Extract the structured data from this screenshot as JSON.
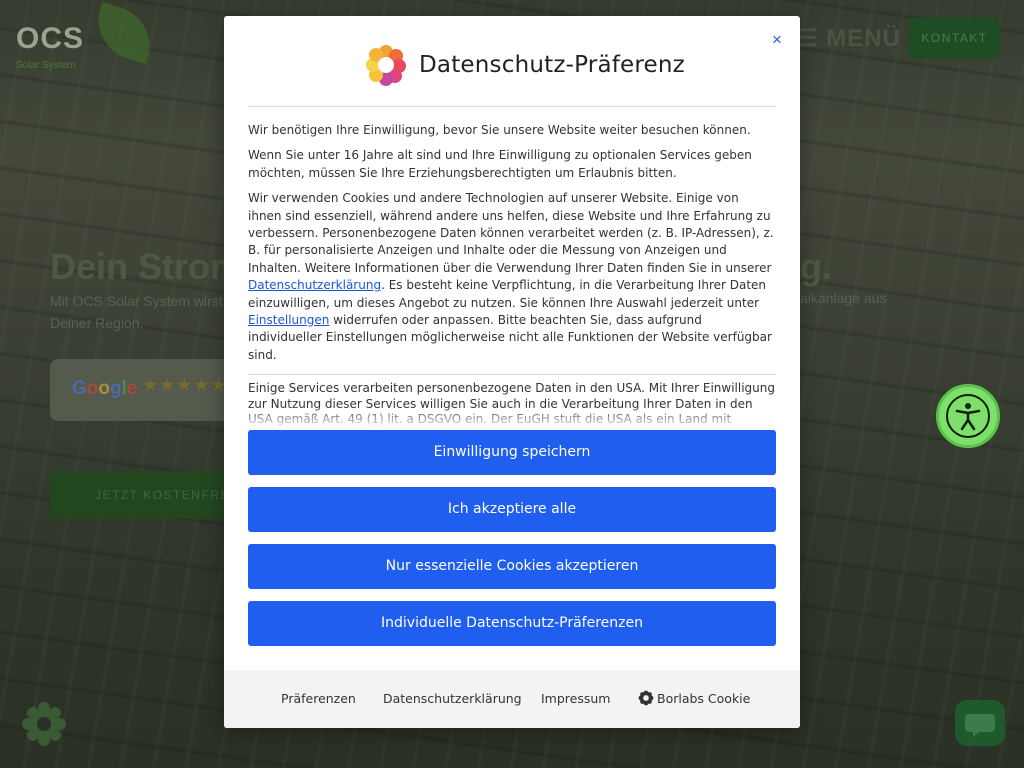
{
  "site": {
    "logo_text": "OCS",
    "logo_sub": "Solar System",
    "menu_label": "MENÜ",
    "contact_label": "KONTAKT",
    "hero_title_left": "Dein Strom",
    "hero_title_right": "g.",
    "hero_sub_left": "Mit OCS Solar System wirst Deiner Region.",
    "hero_sub_right": "aikanlage aus",
    "google_label": "Google",
    "google_stars": "★★★★★",
    "cta_label": "JETZT KOSTENFREIES"
  },
  "dialog": {
    "title": "Datenschutz-Präferenz",
    "close_symbol": "×",
    "paragraph1": "Wir benötigen Ihre Einwilligung, bevor Sie unsere Website weiter besuchen können.",
    "paragraph2": "Wenn Sie unter 16 Jahre alt sind und Ihre Einwilligung zu optionalen Services geben möchten, müssen Sie Ihre Erziehungsberechtigten um Erlaubnis bitten.",
    "paragraph3_part1": "Wir verwenden Cookies und andere Technologien auf unserer Website. Einige von ihnen sind essenziell, während andere uns helfen, diese Website und Ihre Erfahrung zu verbessern. Personenbezogene Daten können verarbeitet werden (z. B. IP-Adressen), z. B. für personalisierte Anzeigen und Inhalte oder die Messung von Anzeigen und Inhalten. Weitere Informationen über die Verwendung Ihrer Daten finden Sie in unserer ",
    "paragraph3_link1": "Datenschutzerklärung",
    "paragraph3_part2": ". Es besteht keine Verpflichtung, in die Verarbeitung Ihrer Daten einzuwilligen, um dieses Angebot zu nutzen. Sie können Ihre Auswahl jederzeit unter ",
    "paragraph3_link2": "Einstellungen",
    "paragraph3_part3": " widerrufen oder anpassen. Bitte beachten Sie, dass aufgrund individueller Einstellungen möglicherweise nicht alle Funktionen der Website verfügbar sind.",
    "usa_text": "Einige Services verarbeiten personenbezogene Daten in den USA. Mit Ihrer Einwilligung zur Nutzung dieser Services willigen Sie auch in die Verarbeitung Ihrer Daten in den USA gemäß Art. 49 (1) lit. a DSGVO ein. Der EuGH stuft die USA als ein Land mit unzureichendem",
    "buttons": {
      "save": "Einwilligung speichern",
      "accept_all": "Ich akzeptiere alle",
      "essential_only": "Nur essenzielle Cookies akzeptieren",
      "individual": "Individuelle Datenschutz-Präferenzen"
    },
    "footer": {
      "preferences": "Präferenzen",
      "privacy": "Datenschutzerklärung",
      "imprint": "Impressum",
      "borlabs": "Borlabs Cookie"
    }
  },
  "colors": {
    "primary_button": "#1f5eef",
    "link": "#1a56d8",
    "accessibility_green": "#7ee06a"
  },
  "icons": {
    "dialog_logo": "flower-logo-icon",
    "close": "close-icon",
    "accessibility": "accessibility-icon",
    "borlabs": "borlabs-cookie-icon",
    "chat": "chat-bubble-icon"
  }
}
